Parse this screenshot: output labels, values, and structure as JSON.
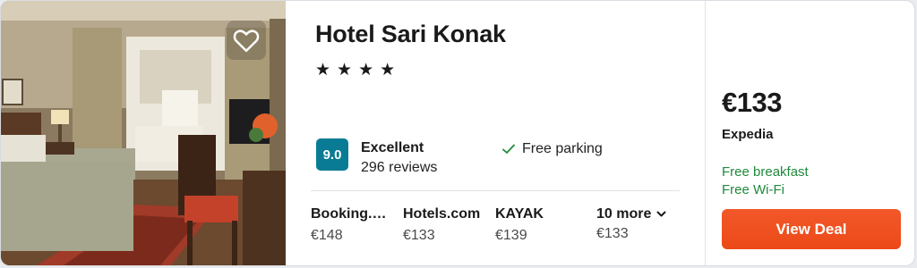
{
  "hotel": {
    "name": "Hotel Sari Konak",
    "stars_text": "★★★★",
    "star_count": 4,
    "score": "9.0",
    "rating_label": "Excellent",
    "reviews": "296 reviews",
    "amenity": "Free parking",
    "image_icon": "hotel-room-photo",
    "favorite_icon": "heart-outline-icon"
  },
  "providers": [
    {
      "name": "Booking.…",
      "price": "€148"
    },
    {
      "name": "Hotels.com",
      "price": "€133"
    },
    {
      "name": "KAYAK",
      "price": "€139"
    }
  ],
  "more": {
    "label": "10 more",
    "price": "€133"
  },
  "deal": {
    "price": "€133",
    "source": "Expedia",
    "perks": [
      "Free breakfast",
      "Free Wi-Fi"
    ],
    "button_label": "View Deal"
  },
  "colors": {
    "score_badge": "#0a7b95",
    "perk_green": "#1f8a3c",
    "button_orange": "#f0501f",
    "check_green": "#1f8a3c"
  }
}
